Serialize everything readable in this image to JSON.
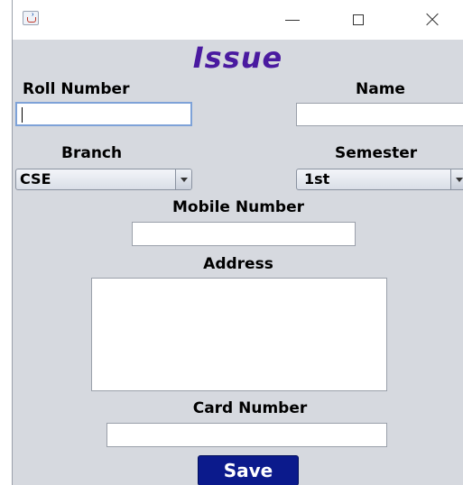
{
  "form": {
    "title": "Issue",
    "roll_number_label": "Roll Number",
    "roll_number_value": "",
    "name_label": "Name",
    "name_value": "",
    "branch_label": "Branch",
    "branch_selected": "CSE",
    "semester_label": "Semester",
    "semester_selected": "1st",
    "mobile_label": "Mobile Number",
    "mobile_value": "",
    "address_label": "Address",
    "address_value": "",
    "card_label": "Card Number",
    "card_value": "",
    "save_label": "Save"
  },
  "colors": {
    "title": "#4a1aa0",
    "save_button": "#0b1a8c",
    "window_bg": "#d6d9df"
  }
}
